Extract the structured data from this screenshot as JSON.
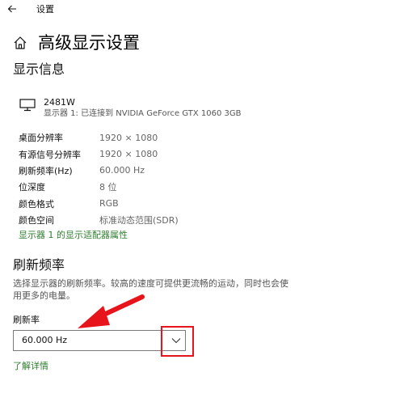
{
  "window": {
    "title": "设置",
    "back_icon": "back-arrow-icon"
  },
  "header": {
    "title": "高级显示设置",
    "home_icon": "home-icon"
  },
  "display_info": {
    "section_title": "显示信息",
    "display_name": "2481W",
    "connection": "显示器 1: 已连接到 NVIDIA GeForce GTX 1060 3GB",
    "rows": [
      {
        "label": "桌面分辨率",
        "value": "1920 × 1080"
      },
      {
        "label": "有源信号分辨率",
        "value": "1920 × 1080"
      },
      {
        "label": "刷新频率(Hz)",
        "value": "60.000 Hz"
      },
      {
        "label": "位深度",
        "value": "8 位"
      },
      {
        "label": "颜色格式",
        "value": "RGB"
      },
      {
        "label": "颜色空间",
        "value": "标准动态范围(SDR)"
      }
    ],
    "adapter_link": "显示器 1 的显示适配器属性"
  },
  "refresh": {
    "section_title": "刷新频率",
    "description": "选择显示器的刷新频率。较高的速度可提供更流畅的运动，同时也会使用更多的电量。",
    "rate_label": "刷新率",
    "selected_rate": "60.000 Hz",
    "learn_more": "了解详情"
  },
  "colors": {
    "link": "#2e7d2e",
    "annotation": "#e8141b"
  }
}
